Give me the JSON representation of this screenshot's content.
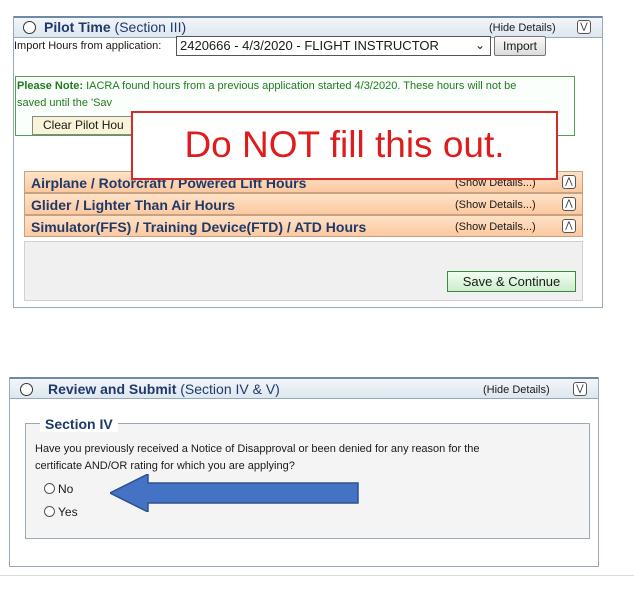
{
  "pilot_time": {
    "title_bold": "Pilot Time",
    "title_sub": "(Section III)",
    "hide_details": "(Hide Details)",
    "import_label": "Import Hours from application:",
    "import_selected": "2420666 - 4/3/2020 - FLIGHT INSTRUCTOR",
    "import_button": "Import",
    "note_bold": "Please Note:",
    "note_line1": "IACRA found hours from a previous application started 4/3/2020. These hours will not be",
    "note_line2": "saved until the 'Sav",
    "clear_button": "Clear Pilot Hou",
    "rows": [
      {
        "label": "Airplane / Rotorcraft / Powered Lift Hours",
        "show": "(Show Details...)"
      },
      {
        "label": "Glider / Lighter Than Air Hours",
        "show": "(Show Details...)"
      },
      {
        "label": "Simulator(FFS) / Training Device(FTD) / ATD Hours",
        "show": "(Show Details...)"
      }
    ],
    "save_button": "Save & Continue"
  },
  "warning": {
    "text": "Do NOT fill this out."
  },
  "review": {
    "title_bold": "Review and Submit",
    "title_sub": "(Section IV & V)",
    "hide_details": "(Hide Details)",
    "section_legend": "Section IV",
    "question_line1": "Have you previously received a Notice of Disapproval or been denied for any reason for the",
    "question_line2": "certificate AND/OR rating for which you are applying?",
    "options": [
      "No",
      "Yes"
    ]
  },
  "annotation": {
    "arrow_color": "#4472c4",
    "warning_color": "#e01b1b"
  }
}
